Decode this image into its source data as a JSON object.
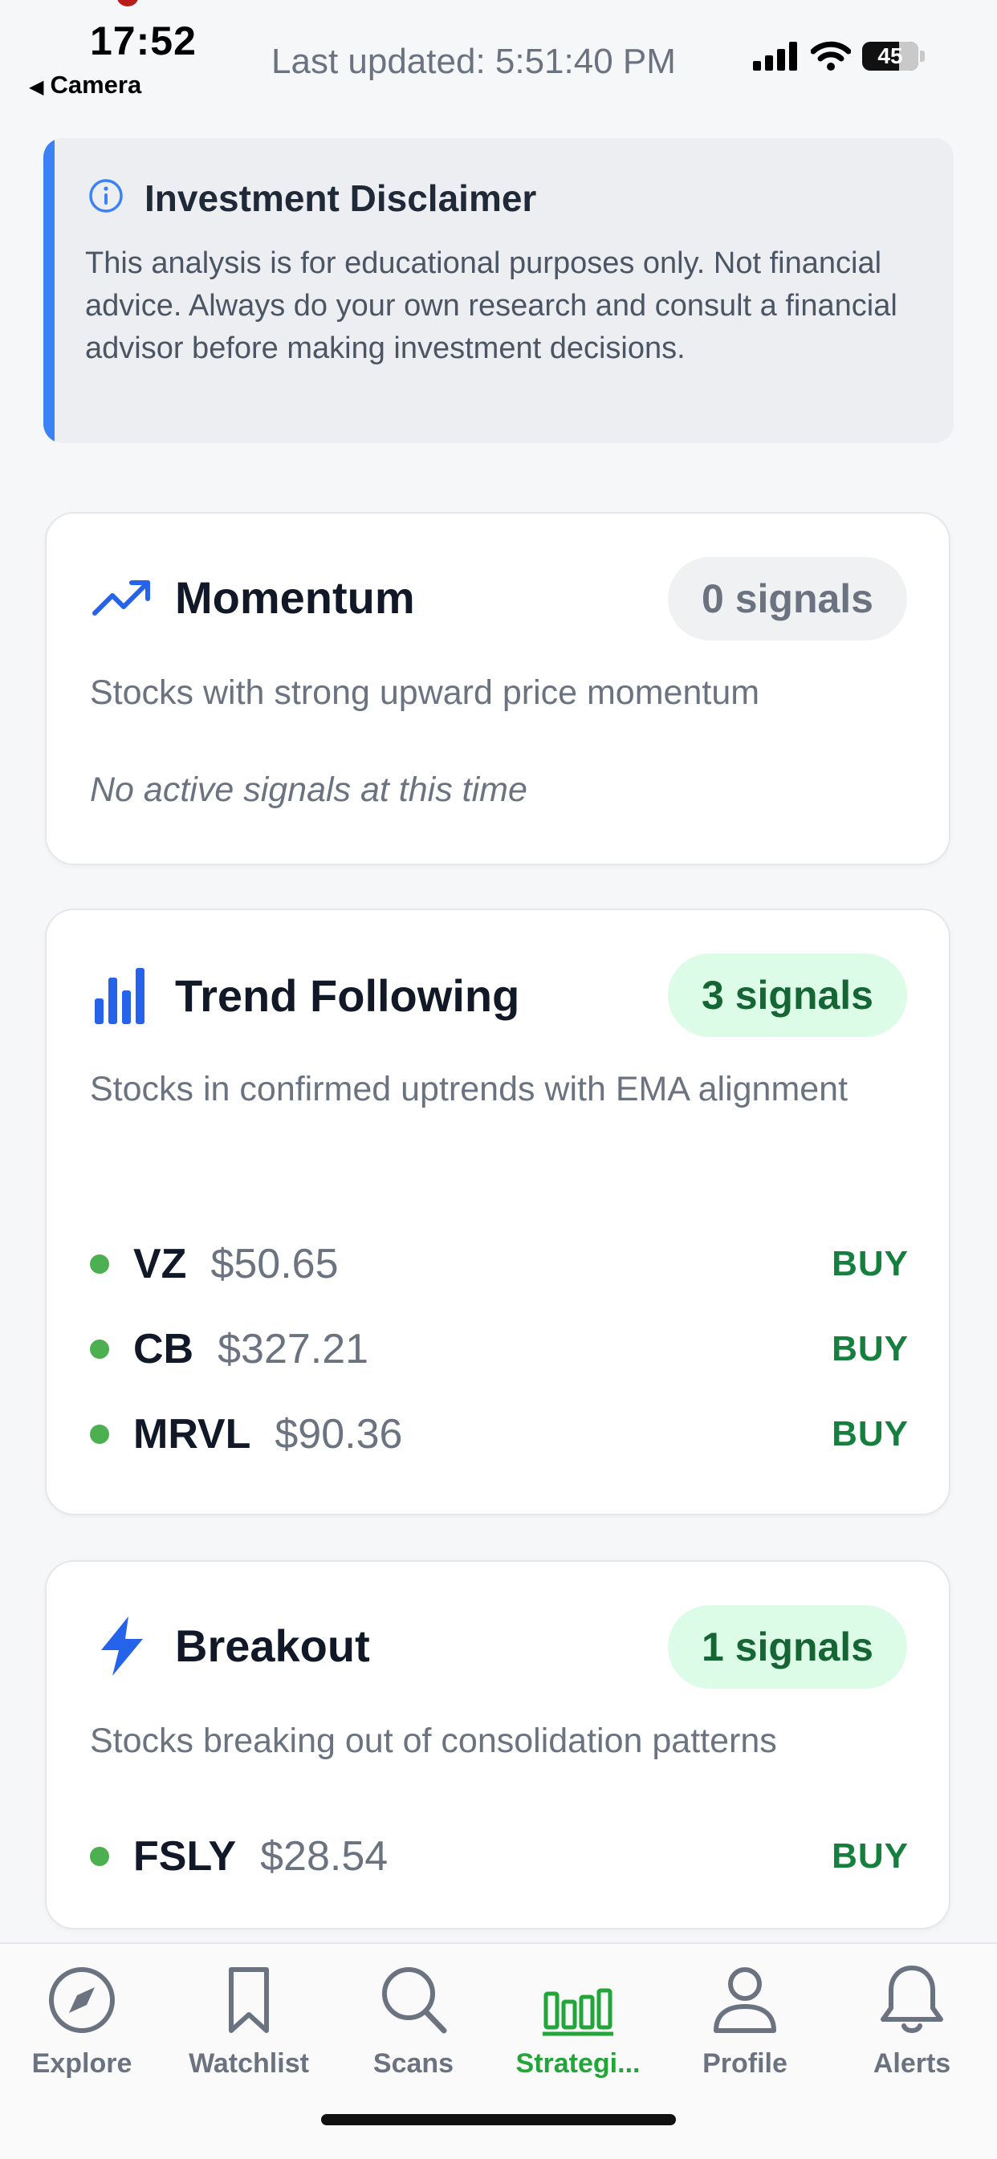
{
  "status_bar": {
    "time": "17:52",
    "back_label": "Camera",
    "last_updated": "Last updated: 5:51:40 PM",
    "battery": "45"
  },
  "disclaimer": {
    "title": "Investment Disclaimer",
    "body": "This analysis is for educational purposes only. Not financial advice. Always do your own research and consult a financial advisor before making investment decisions.",
    "accent_color": "#3b82f6",
    "icon": "info-circle-icon"
  },
  "strategies": [
    {
      "title": "Momentum",
      "icon": "trending-up-icon",
      "badge": "0 signals",
      "description": "Stocks with strong upward price momentum",
      "empty_text": "No active signals at this time",
      "signals": []
    },
    {
      "title": "Trend Following",
      "icon": "bar-chart-icon",
      "badge": "3 signals",
      "description": "Stocks in confirmed uptrends with EMA alignment",
      "signals": [
        {
          "ticker": "VZ",
          "price": "$50.65",
          "action": "BUY"
        },
        {
          "ticker": "CB",
          "price": "$327.21",
          "action": "BUY"
        },
        {
          "ticker": "MRVL",
          "price": "$90.36",
          "action": "BUY"
        }
      ]
    },
    {
      "title": "Breakout",
      "icon": "lightning-icon",
      "badge": "1 signals",
      "description": "Stocks breaking out of consolidation patterns",
      "signals": [
        {
          "ticker": "FSLY",
          "price": "$28.54",
          "action": "BUY"
        }
      ]
    }
  ],
  "tab_bar": {
    "active_color": "#22a63a",
    "items": [
      {
        "label": "Explore",
        "icon": "compass-icon"
      },
      {
        "label": "Watchlist",
        "icon": "bookmark-icon"
      },
      {
        "label": "Scans",
        "icon": "search-icon"
      },
      {
        "label": "Strategi...",
        "icon": "bar-chart-icon"
      },
      {
        "label": "Profile",
        "icon": "person-icon"
      },
      {
        "label": "Alerts",
        "icon": "bell-icon"
      }
    ],
    "active_index": 3
  }
}
